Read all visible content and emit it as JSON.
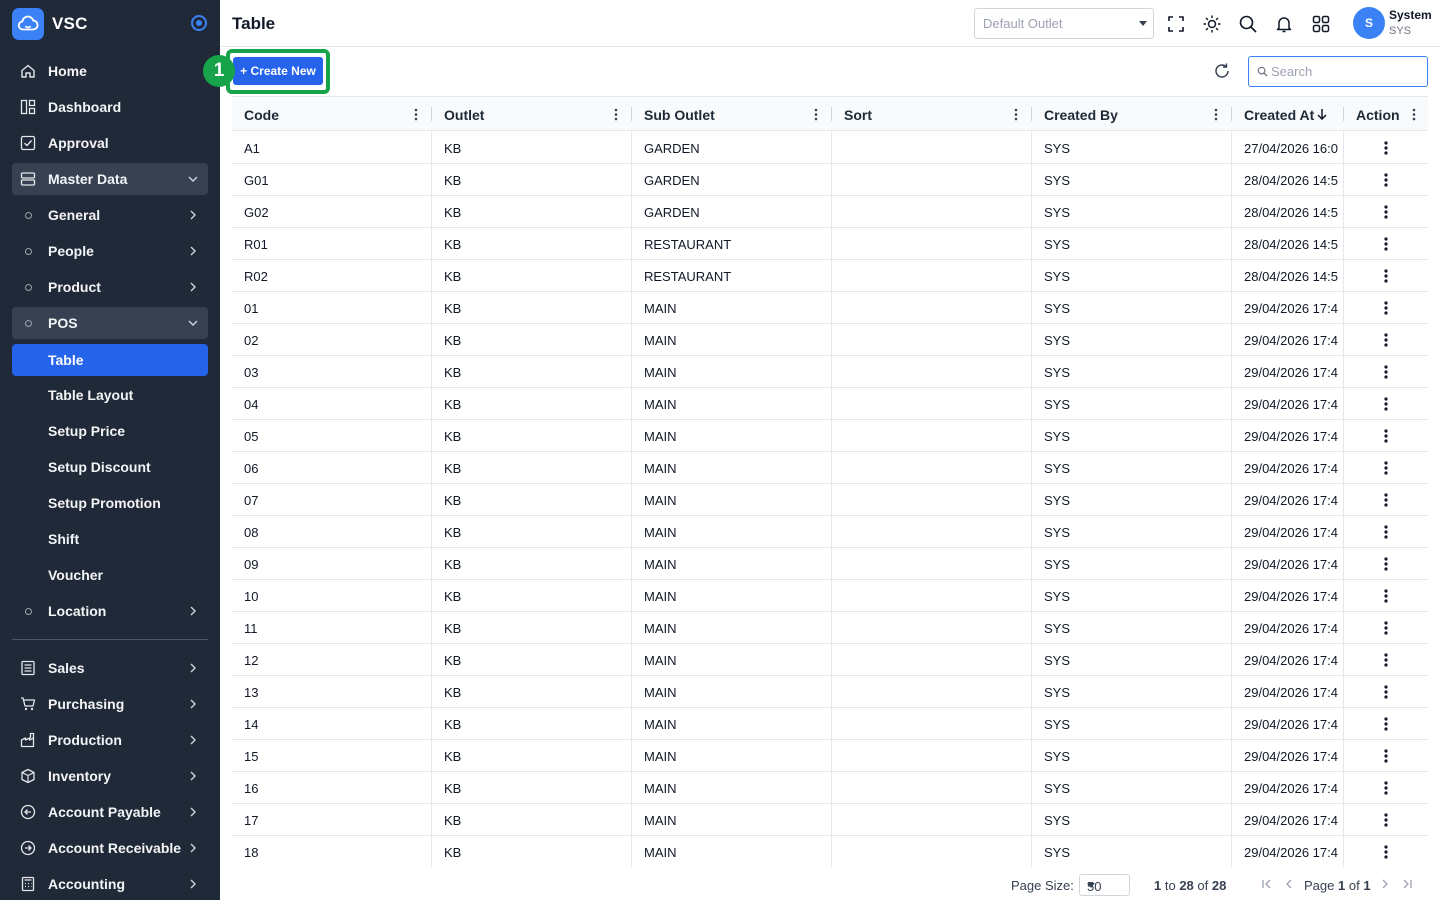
{
  "app": {
    "name": "VSC"
  },
  "sidebar": {
    "items": [
      {
        "label": "Home",
        "icon": "home-icon",
        "top": 0
      },
      {
        "label": "Dashboard",
        "icon": "dashboard-icon"
      },
      {
        "label": "Approval",
        "icon": "approval-icon"
      },
      {
        "label": "Master Data",
        "icon": "database-icon"
      },
      {
        "label": "General",
        "icon": "circle-icon"
      },
      {
        "label": "People",
        "icon": "circle-icon"
      },
      {
        "label": "Product",
        "icon": "circle-icon"
      },
      {
        "label": "POS",
        "icon": "circle-icon"
      },
      {
        "label": "Table"
      },
      {
        "label": "Table Layout"
      },
      {
        "label": "Setup Price"
      },
      {
        "label": "Setup Discount"
      },
      {
        "label": "Setup Promotion"
      },
      {
        "label": "Shift"
      },
      {
        "label": "Voucher"
      },
      {
        "label": "Location",
        "icon": "circle-icon"
      },
      {
        "label": "Sales",
        "icon": "sales-icon"
      },
      {
        "label": "Purchasing",
        "icon": "cart-icon"
      },
      {
        "label": "Production",
        "icon": "production-icon"
      },
      {
        "label": "Inventory",
        "icon": "box-icon"
      },
      {
        "label": "Account Payable",
        "icon": "arrow-left-circle-icon"
      },
      {
        "label": "Account Receivable",
        "icon": "arrow-right-circle-icon"
      },
      {
        "label": "Accounting",
        "icon": "calculator-icon"
      }
    ]
  },
  "header": {
    "title": "Table",
    "outlet_placeholder": "Default Outlet",
    "user_name": "System",
    "user_code": "SYS",
    "avatar_initial": "S"
  },
  "toolbar": {
    "create_label": "+ Create New",
    "step_number": "1",
    "search_placeholder": "Search"
  },
  "grid": {
    "columns": [
      "Code",
      "Outlet",
      "Sub Outlet",
      "Sort",
      "Created By",
      "Created At",
      "Action"
    ],
    "rows": [
      [
        "A1",
        "KB",
        "GARDEN",
        "",
        "SYS",
        "27/04/2026 16:0"
      ],
      [
        "G01",
        "KB",
        "GARDEN",
        "",
        "SYS",
        "28/04/2026 14:5"
      ],
      [
        "G02",
        "KB",
        "GARDEN",
        "",
        "SYS",
        "28/04/2026 14:5"
      ],
      [
        "R01",
        "KB",
        "RESTAURANT",
        "",
        "SYS",
        "28/04/2026 14:5"
      ],
      [
        "R02",
        "KB",
        "RESTAURANT",
        "",
        "SYS",
        "28/04/2026 14:5"
      ],
      [
        "01",
        "KB",
        "MAIN",
        "",
        "SYS",
        "29/04/2026 17:4"
      ],
      [
        "02",
        "KB",
        "MAIN",
        "",
        "SYS",
        "29/04/2026 17:4"
      ],
      [
        "03",
        "KB",
        "MAIN",
        "",
        "SYS",
        "29/04/2026 17:4"
      ],
      [
        "04",
        "KB",
        "MAIN",
        "",
        "SYS",
        "29/04/2026 17:4"
      ],
      [
        "05",
        "KB",
        "MAIN",
        "",
        "SYS",
        "29/04/2026 17:4"
      ],
      [
        "06",
        "KB",
        "MAIN",
        "",
        "SYS",
        "29/04/2026 17:4"
      ],
      [
        "07",
        "KB",
        "MAIN",
        "",
        "SYS",
        "29/04/2026 17:4"
      ],
      [
        "08",
        "KB",
        "MAIN",
        "",
        "SYS",
        "29/04/2026 17:4"
      ],
      [
        "09",
        "KB",
        "MAIN",
        "",
        "SYS",
        "29/04/2026 17:4"
      ],
      [
        "10",
        "KB",
        "MAIN",
        "",
        "SYS",
        "29/04/2026 17:4"
      ],
      [
        "11",
        "KB",
        "MAIN",
        "",
        "SYS",
        "29/04/2026 17:4"
      ],
      [
        "12",
        "KB",
        "MAIN",
        "",
        "SYS",
        "29/04/2026 17:4"
      ],
      [
        "13",
        "KB",
        "MAIN",
        "",
        "SYS",
        "29/04/2026 17:4"
      ],
      [
        "14",
        "KB",
        "MAIN",
        "",
        "SYS",
        "29/04/2026 17:4"
      ],
      [
        "15",
        "KB",
        "MAIN",
        "",
        "SYS",
        "29/04/2026 17:4"
      ],
      [
        "16",
        "KB",
        "MAIN",
        "",
        "SYS",
        "29/04/2026 17:4"
      ],
      [
        "17",
        "KB",
        "MAIN",
        "",
        "SYS",
        "29/04/2026 17:4"
      ],
      [
        "18",
        "KB",
        "MAIN",
        "",
        "SYS",
        "29/04/2026 17:4"
      ]
    ]
  },
  "pager": {
    "page_size_label": "Page Size:",
    "page_size": "50",
    "range_from": "1",
    "range_to_text": "to",
    "range_to": "28",
    "range_of_text": "of",
    "range_total": "28",
    "page_text": "Page",
    "page_current": "1",
    "page_of_text": "of",
    "page_total": "1"
  },
  "colors": {
    "sidebar_bg": "#1f2937",
    "accent": "#2563eb",
    "highlight": "#16a34a"
  }
}
